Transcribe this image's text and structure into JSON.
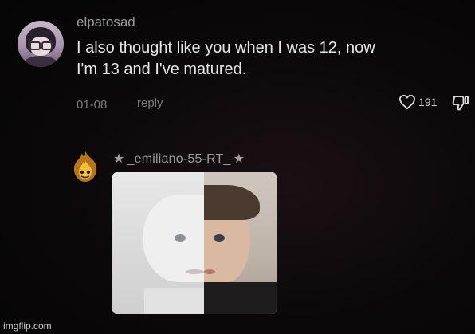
{
  "comment": {
    "username": "elpatosad",
    "text_line1": "I also thought like you when I was 12, now",
    "text_line2": "I'm 13 and I've matured.",
    "date": "01-08",
    "reply_label": "reply",
    "like_count": "191"
  },
  "reply_preview": {
    "star": "★",
    "username": "_emiliano-55-RT_"
  },
  "watermark": "imgflip.com",
  "colors": {
    "background": "#0b0809",
    "username": "#9a9a9a",
    "comment_text": "#e6e6e6",
    "meta_text": "#7c7c7c"
  },
  "icons": {
    "like": "heart-outline-icon",
    "dislike": "thumbs-down-icon"
  }
}
